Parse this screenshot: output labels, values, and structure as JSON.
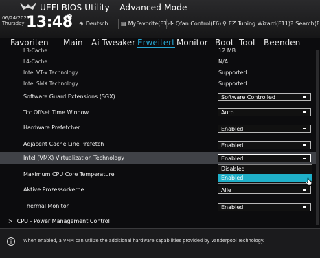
{
  "header": {
    "title": "UEFI BIOS Utility – Advanced Mode",
    "date": "06/24/2021",
    "day": "Thursday",
    "time": "13:48",
    "toolbar": [
      {
        "icon": "globe-icon",
        "label": "Deutsch"
      },
      {
        "icon": "favorites-icon",
        "label": "MyFavorite(F3)"
      },
      {
        "icon": "fan-icon",
        "label": "Qfan Control(F6)"
      },
      {
        "icon": "bulb-icon",
        "label": "EZ Tuning Wizard(F11)"
      },
      {
        "icon": "search-icon",
        "label": "Search(F9"
      }
    ]
  },
  "nav": {
    "tabs": [
      "Favoriten",
      "Main",
      "Ai Tweaker",
      "Erweitert",
      "Monitor",
      "Boot",
      "Tool",
      "Beenden"
    ],
    "active": "Erweitert"
  },
  "rows": [
    {
      "label": "L3-Cache",
      "value": "12 MB",
      "type": "info"
    },
    {
      "label": "L4-Cache",
      "value": "N/A",
      "type": "info"
    },
    {
      "label": "Intel VT-x Technology",
      "value": "Supported",
      "type": "info"
    },
    {
      "label": "Intel SMX Technology",
      "value": "Supported",
      "type": "info"
    },
    {
      "label": "Software Guard Extensions (SGX)",
      "value": "Software Controlled",
      "type": "select"
    },
    {
      "label": "Tcc Offset Time Window",
      "value": "Auto",
      "type": "select"
    },
    {
      "label": "Hardware Prefetcher",
      "value": "Enabled",
      "type": "select"
    },
    {
      "label": "Adjacent Cache Line Prefetch",
      "value": "Enabled",
      "type": "select"
    },
    {
      "label": "Intel (VMX) Virtualization Technology",
      "value": "Enabled",
      "type": "select"
    },
    {
      "label": "Maximum CPU Core Temperature",
      "value": "",
      "type": "select"
    },
    {
      "label": "Aktive Prozessorkerne",
      "value": "Alle",
      "type": "select"
    },
    {
      "label": "Thermal Monitor",
      "value": "Enabled",
      "type": "select"
    }
  ],
  "dropdown": {
    "options": [
      "Disabled",
      "Enabled"
    ],
    "selected": "Enabled"
  },
  "submenu": "CPU - Power Management Control",
  "help_text": "When enabled, a VMM can utilize the additional hardware capabilities provided by Vanderpool Technology.",
  "colors": {
    "accent": "#27a8d6",
    "highlight_row": "#404247",
    "dropdown_selected": "#1fb0c9"
  }
}
